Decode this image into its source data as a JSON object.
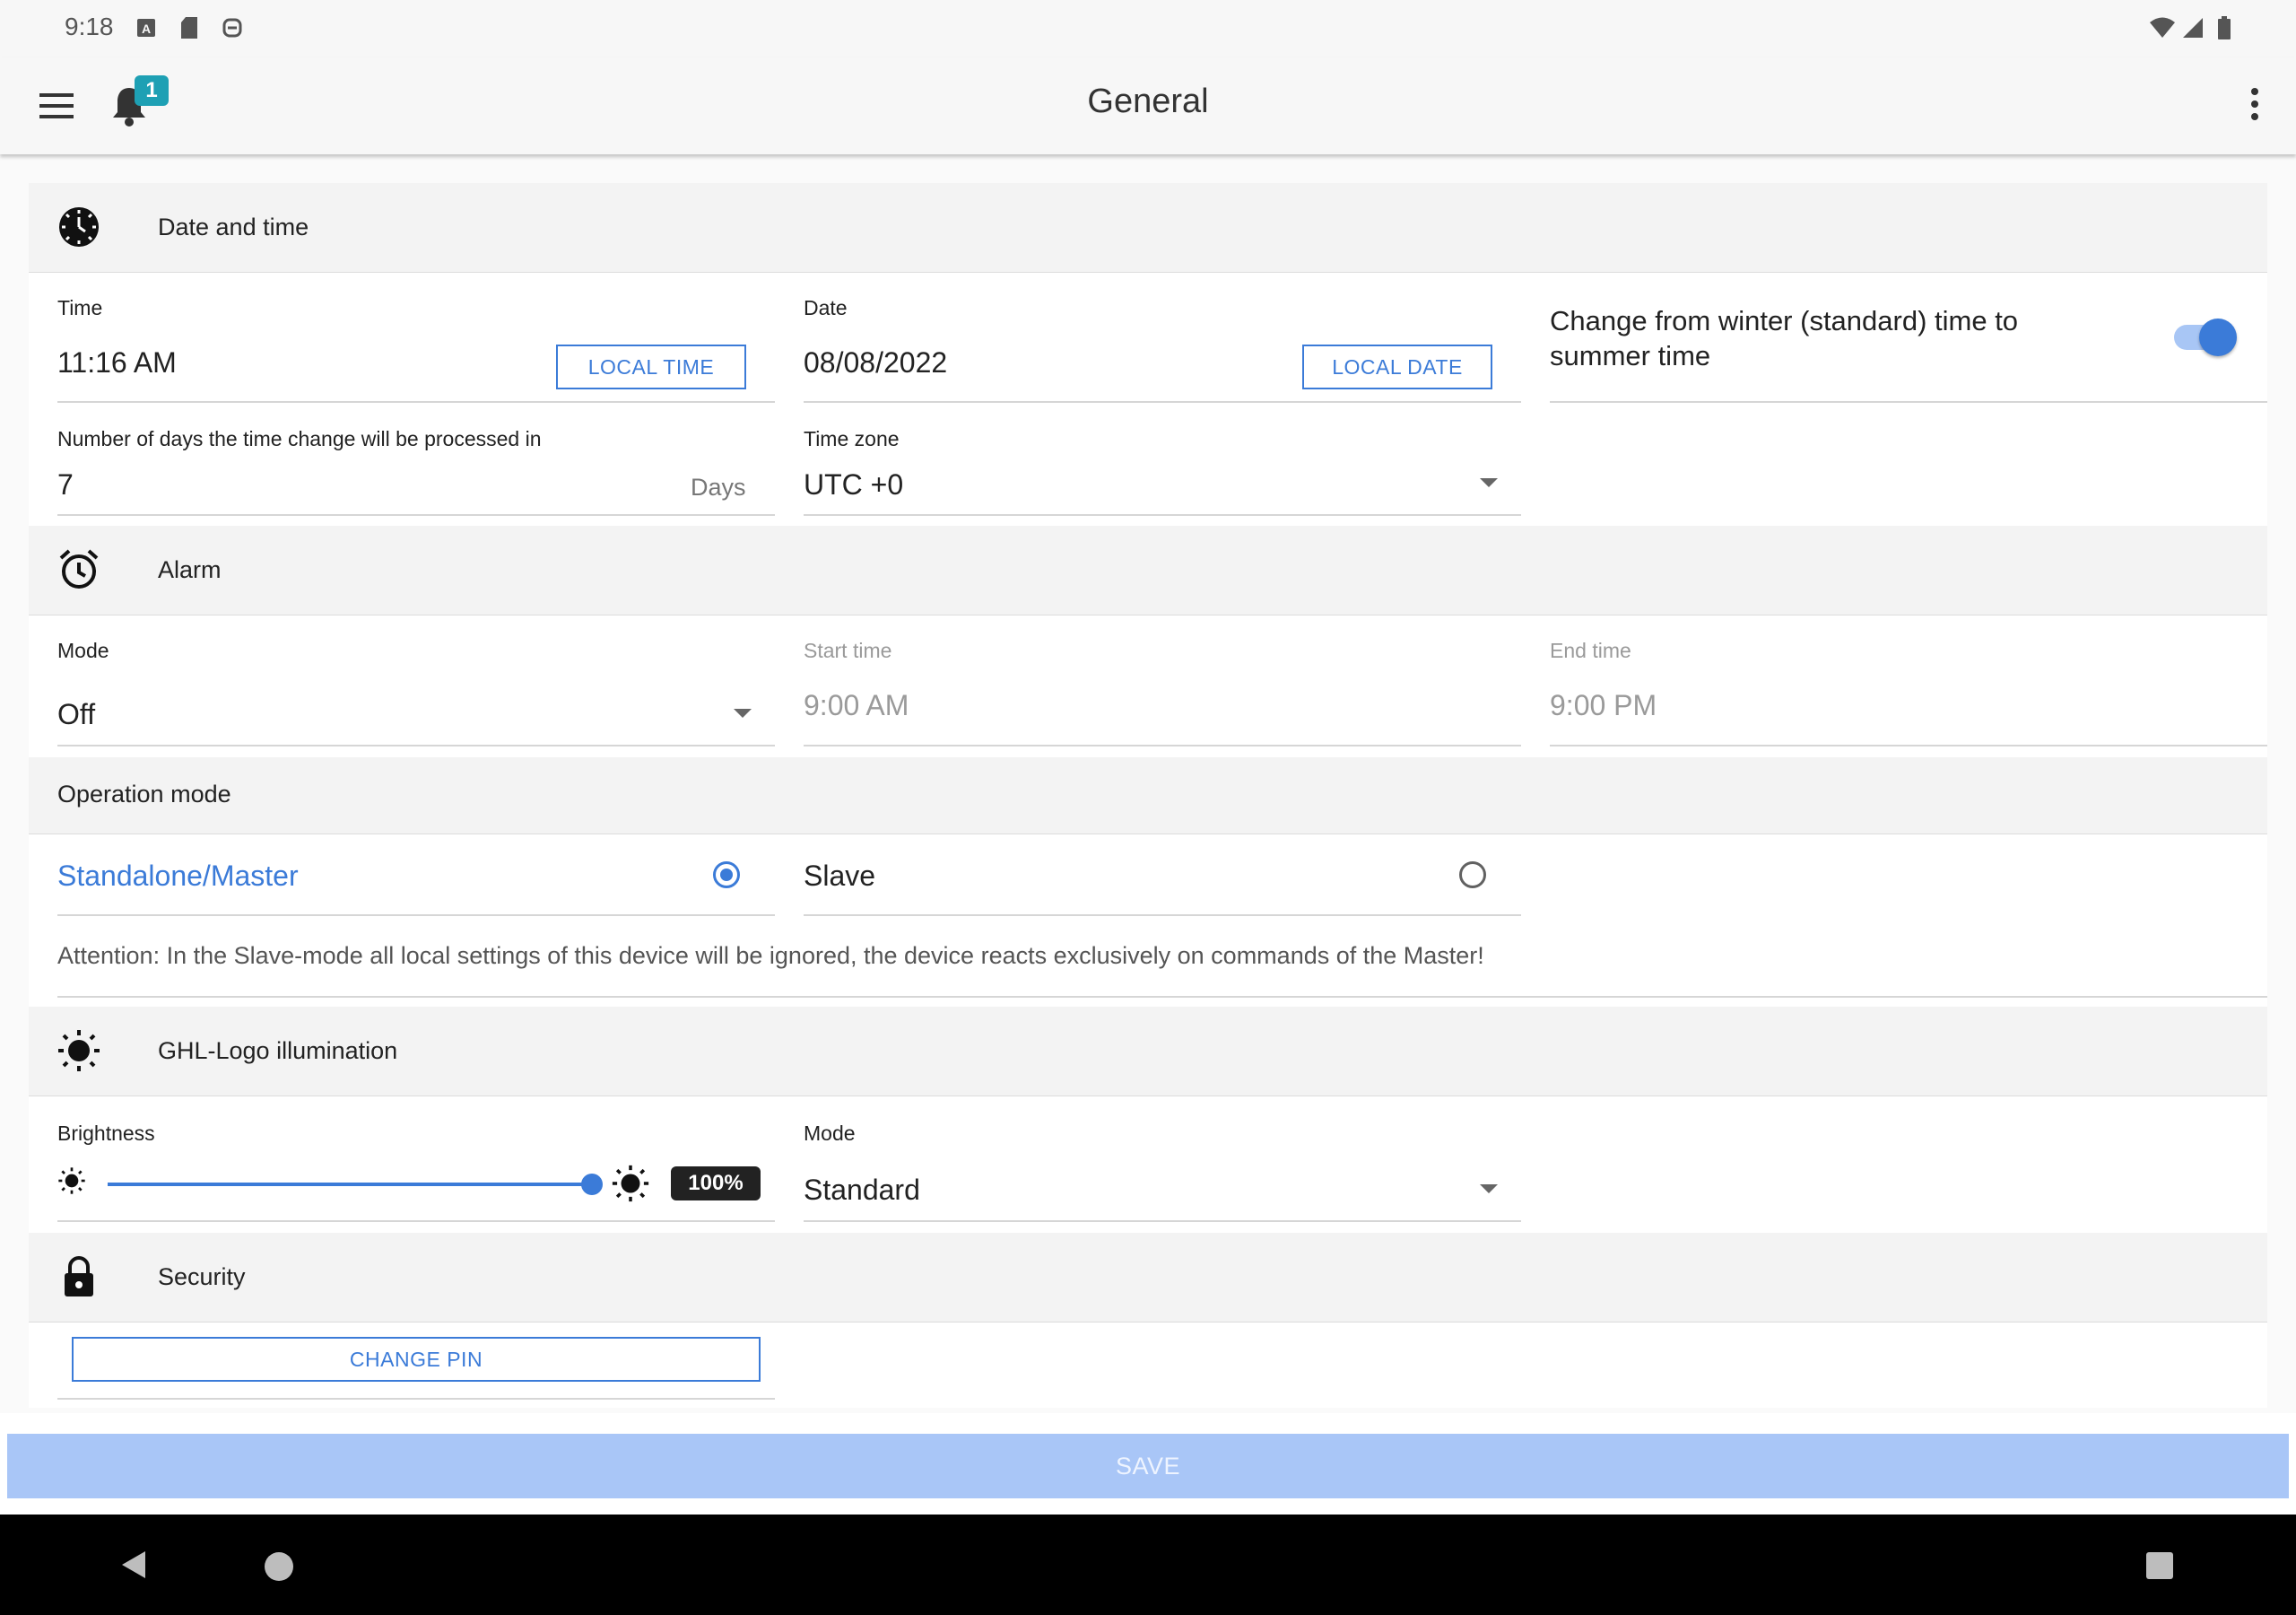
{
  "status_bar": {
    "time": "9:18",
    "left_icons": [
      "a-icon",
      "sd-card-icon",
      "cloud-sync-icon"
    ],
    "right_icons": [
      "wifi-icon",
      "cell-signal-icon",
      "battery-icon"
    ]
  },
  "app_bar": {
    "title": "General",
    "notification_count": "1",
    "accent_color": "#1ea0b4"
  },
  "date_time": {
    "title": "Date and time",
    "time_label": "Time",
    "time_value": "11:16 AM",
    "local_time_button": "LOCAL TIME",
    "date_label": "Date",
    "date_value": "08/08/2022",
    "local_date_button": "LOCAL DATE",
    "dst_label": "Change from winter (standard) time to summer time",
    "dst_enabled": true,
    "days_label": "Number of days the time change will be processed in",
    "days_value": "7",
    "days_unit": "Days",
    "timezone_label": "Time zone",
    "timezone_value": "UTC +0"
  },
  "alarm": {
    "title": "Alarm",
    "mode_label": "Mode",
    "mode_value": "Off",
    "start_label": "Start time",
    "start_value": "9:00 AM",
    "end_label": "End time",
    "end_value": "9:00 PM"
  },
  "operation_mode": {
    "title": "Operation mode",
    "option_master": "Standalone/Master",
    "option_slave": "Slave",
    "selected": "Standalone/Master",
    "attention": "Attention: In the Slave-mode all local settings of this device will be ignored, the device reacts exclusively on commands of the Master!"
  },
  "logo_illumination": {
    "title": "GHL-Logo illumination",
    "brightness_label": "Brightness",
    "brightness_fraction": 1.0,
    "brightness_text": "100%",
    "mode_label": "Mode",
    "mode_value": "Standard"
  },
  "security": {
    "title": "Security",
    "change_pin_button": "CHANGE PIN"
  },
  "save_button": "SAVE",
  "colors": {
    "accent": "#3b7bd8",
    "save_disabled": "#a9c6f7"
  }
}
